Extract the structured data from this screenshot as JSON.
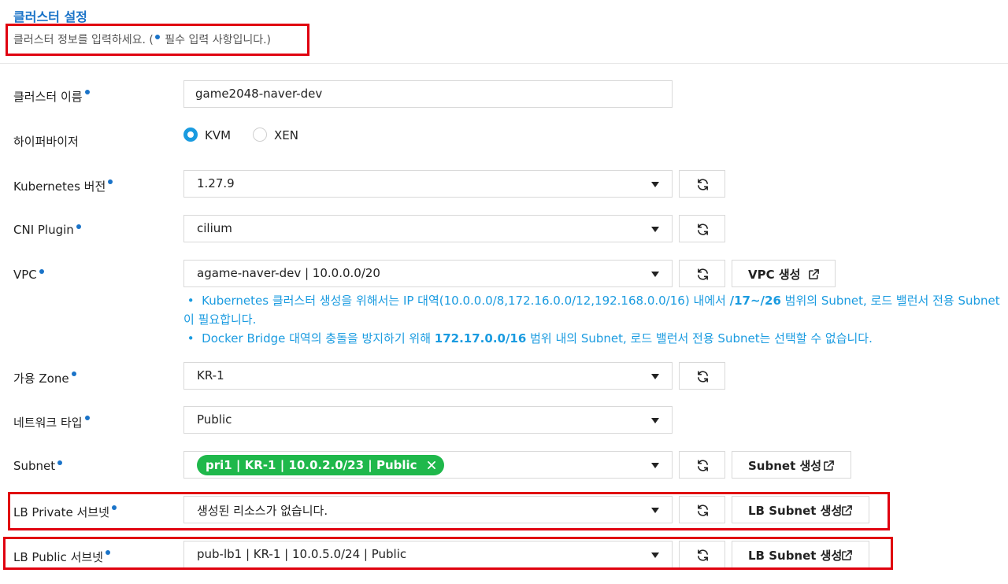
{
  "header": {
    "title": "클러스터 설정",
    "subtitle_pre": "클러스터 정보를 입력하세요. (",
    "subtitle_post": " 필수 입력 사항입니다.)"
  },
  "fields": {
    "cluster_name": {
      "label": "클러스터 이름",
      "value": "game2048-naver-dev"
    },
    "hypervisor": {
      "label": "하이퍼바이저",
      "options": [
        "KVM",
        "XEN"
      ],
      "selected": "KVM"
    },
    "k8s_version": {
      "label": "Kubernetes 버전",
      "value": "1.27.9"
    },
    "cni_plugin": {
      "label": "CNI Plugin",
      "value": "cilium"
    },
    "vpc": {
      "label": "VPC",
      "value": "agame-naver-dev | 10.0.0.0/20",
      "create_label": "VPC 생성"
    },
    "zone": {
      "label": "가용 Zone",
      "value": "KR-1"
    },
    "network_type": {
      "label": "네트워크 타입",
      "value": "Public"
    },
    "subnet": {
      "label": "Subnet",
      "chip": "pri1 | KR-1 | 10.0.2.0/23 | Public",
      "create_label": "Subnet 생성"
    },
    "lb_private": {
      "label": "LB Private 서브넷",
      "value": "생성된 리소스가 없습니다.",
      "create_label": "LB Subnet 생성"
    },
    "lb_public": {
      "label": "LB Public 서브넷",
      "value": "pub-lb1 | KR-1 | 10.0.5.0/24 | Public",
      "create_label": "LB Subnet 생성"
    }
  },
  "notes": {
    "note1_a": "Kubernetes 클러스터 생성을 위해서는 IP 대역(10.0.0.0/8,172.16.0.0/12,192.168.0.0/16) 내에서 ",
    "note1_b": "/17~/26",
    "note1_c": " 범위의 Subnet, 로드 밸런서 전용 Subnet이 필요합니다.",
    "note2_a": "Docker Bridge 대역의 충돌을 방지하기 위해 ",
    "note2_b": "172.17.0.0/16",
    "note2_c": " 범위 내의 Subnet, 로드 밸런서 전용 Subnet는 선택할 수 없습니다."
  },
  "colors": {
    "accent": "#1a73c8",
    "info": "#1a9be0",
    "chip": "#1fb84b",
    "highlight": "#e0000f"
  }
}
